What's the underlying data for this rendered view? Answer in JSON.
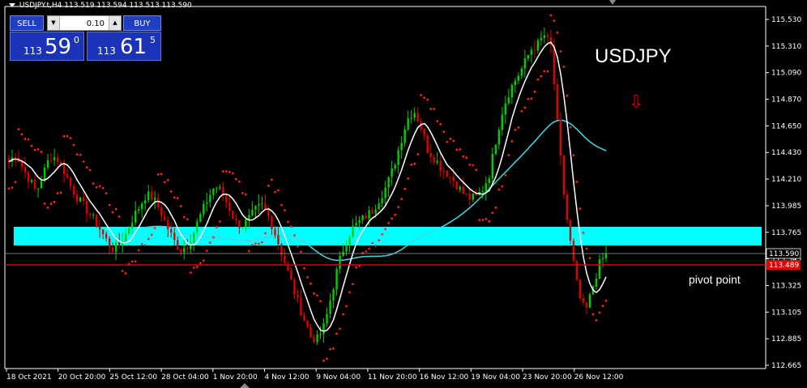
{
  "header": {
    "symbol": "USDJPY.t,H4",
    "ohlc": "113.519 113.594 113.513 113.590"
  },
  "one_click": {
    "sell_label": "SELL",
    "buy_label": "BUY",
    "lot": "0.10",
    "sell_price_small": "113",
    "sell_price_big": "59",
    "sell_price_sup": "0",
    "buy_price_small": "113",
    "buy_price_big": "61",
    "buy_price_sup": "5"
  },
  "annotations": {
    "symbol_text": "USDJPY",
    "pivot_text": "pivot point",
    "arrow": "⇩"
  },
  "colors": {
    "background": "#000000",
    "bull_candle": "#00d000",
    "bear_candle": "#e00000",
    "sar_dots": "#ff2020",
    "ma_fast": "#ffffff",
    "ma_slow": "#40d8e8",
    "zone": "#00ffff",
    "pivot_line": "#e00000",
    "price_line": "#c0c0c0"
  },
  "chart_data": {
    "type": "candlestick",
    "y_axis_ticks": [
      "115.530",
      "115.310",
      "115.090",
      "114.870",
      "114.650",
      "114.430",
      "114.210",
      "113.985",
      "113.765",
      "113.545",
      "113.325",
      "113.105",
      "112.885",
      "112.665"
    ],
    "ylim": [
      112.665,
      115.53
    ],
    "x_axis_ticks": [
      "18 Oct 2021",
      "20 Oct 20:00",
      "25 Oct 12:00",
      "28 Oct 04:00",
      "1 Nov 20:00",
      "4 Nov 12:00",
      "9 Nov 04:00",
      "11 Nov 20:00",
      "16 Nov 12:00",
      "19 Nov 04:00",
      "23 Nov 20:00",
      "26 Nov 12:00"
    ],
    "current_price": "113.590",
    "pivot_price": "113.489",
    "support_zone": [
      113.6,
      113.76
    ],
    "close_path": [
      114.35,
      114.42,
      114.3,
      114.2,
      114.1,
      114.25,
      114.4,
      114.38,
      114.28,
      114.15,
      114.05,
      113.98,
      113.9,
      113.82,
      113.72,
      113.63,
      113.66,
      113.75,
      113.88,
      113.98,
      114.08,
      114.05,
      113.95,
      113.82,
      113.7,
      113.62,
      113.66,
      113.78,
      113.92,
      114.05,
      114.15,
      114.1,
      113.98,
      113.85,
      113.82,
      113.88,
      113.96,
      113.99,
      113.88,
      113.72,
      113.55,
      113.38,
      113.2,
      113.05,
      112.9,
      112.88,
      113.0,
      113.25,
      113.5,
      113.68,
      113.8,
      113.85,
      113.9,
      113.95,
      114.05,
      114.15,
      114.3,
      114.5,
      114.7,
      114.78,
      114.65,
      114.45,
      114.38,
      114.3,
      114.25,
      114.18,
      114.1,
      114.05,
      114.05,
      114.12,
      114.25,
      114.55,
      114.8,
      114.95,
      115.05,
      115.15,
      115.28,
      115.32,
      115.4,
      115.3,
      114.6,
      114.0,
      113.6,
      113.25,
      113.1,
      113.3,
      113.5,
      113.59
    ],
    "series": [
      {
        "name": "",
        "type": "line"
      },
      {
        "name": "",
        "type": "line"
      },
      {
        "name": "",
        "type": "dots"
      }
    ]
  }
}
